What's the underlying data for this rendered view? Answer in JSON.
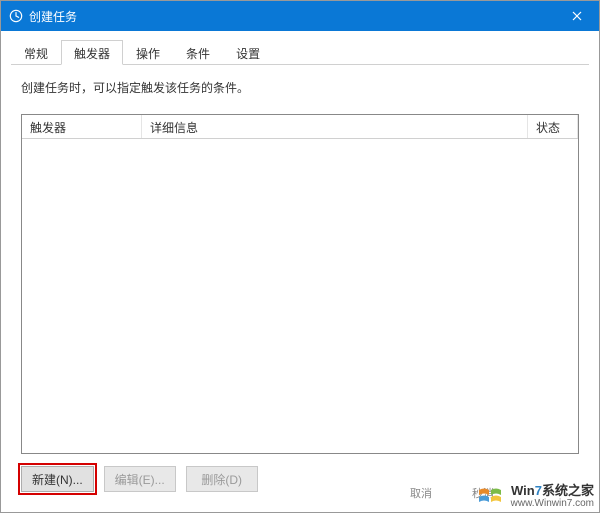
{
  "titlebar": {
    "title": "创建任务"
  },
  "tabs": {
    "items": [
      {
        "label": "常规"
      },
      {
        "label": "触发器"
      },
      {
        "label": "操作"
      },
      {
        "label": "条件"
      },
      {
        "label": "设置"
      }
    ],
    "active_index": 1
  },
  "triggers_tab": {
    "description": "创建任务时，可以指定触发该任务的条件。",
    "columns": {
      "trigger": "触发器",
      "detail": "详细信息",
      "status": "状态"
    },
    "rows": []
  },
  "buttons": {
    "new": "新建(N)...",
    "edit": "编辑(E)...",
    "delete": "删除(D)"
  },
  "watermark": {
    "brand_prefix": "Win",
    "brand_accent": "7",
    "brand_suffix": "系统之家",
    "url": "www.Winwin7.com",
    "ghost_cancel": "取消",
    "ghost_secs": "秒消"
  }
}
